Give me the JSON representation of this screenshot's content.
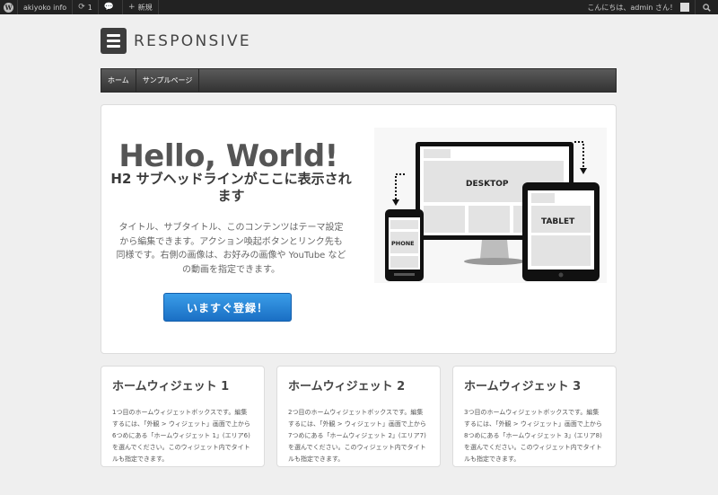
{
  "adminbar": {
    "wp_logo_letter": "W",
    "site_name": "akiyoko info",
    "updates_count": "1",
    "new_label": "新規",
    "greeting": "こんにちは、admin さん！"
  },
  "header": {
    "logo_text": "RESPONSIVE"
  },
  "nav": {
    "items": [
      "ホーム",
      "サンプルページ"
    ]
  },
  "hero": {
    "title": "Hello, World!",
    "subtitle": "H2 サブヘッドラインがここに表示されます",
    "text": "タイトル、サブタイトル、このコンテンツはテーマ設定から編集できます。アクション喚起ボタンとリンク先も同様です。右側の画像は、お好みの画像や YouTube などの動画を指定できます。",
    "cta_label": "いますぐ登録！",
    "device_labels": {
      "desktop": "DESKTOP",
      "tablet": "TABLET",
      "phone": "PHONE"
    }
  },
  "widgets": [
    {
      "title": "ホームウィジェット 1",
      "text": "1つ目のホームウィジェットボックスです。編集するには、「外観 > ウィジェット」画面で上から6つめにある「ホームウィジェット 1」(エリア6) を選んでください。このウィジェット内でタイトルも指定できます。"
    },
    {
      "title": "ホームウィジェット 2",
      "text": "2つ目のホームウィジェットボックスです。編集するには、「外観 > ウィジェット」画面で上から7つめにある「ホームウィジェット 2」(エリア7) を選んでください。このウィジェット内でタイトルも指定できます。"
    },
    {
      "title": "ホームウィジェット 3",
      "text": "3つ目のホームウィジェットボックスです。編集するには、「外観 > ウィジェット」画面で上から8つめにある「ホームウィジェット 3」(エリア8) を選んでください。このウィジェット内でタイトルも指定できます。"
    }
  ]
}
